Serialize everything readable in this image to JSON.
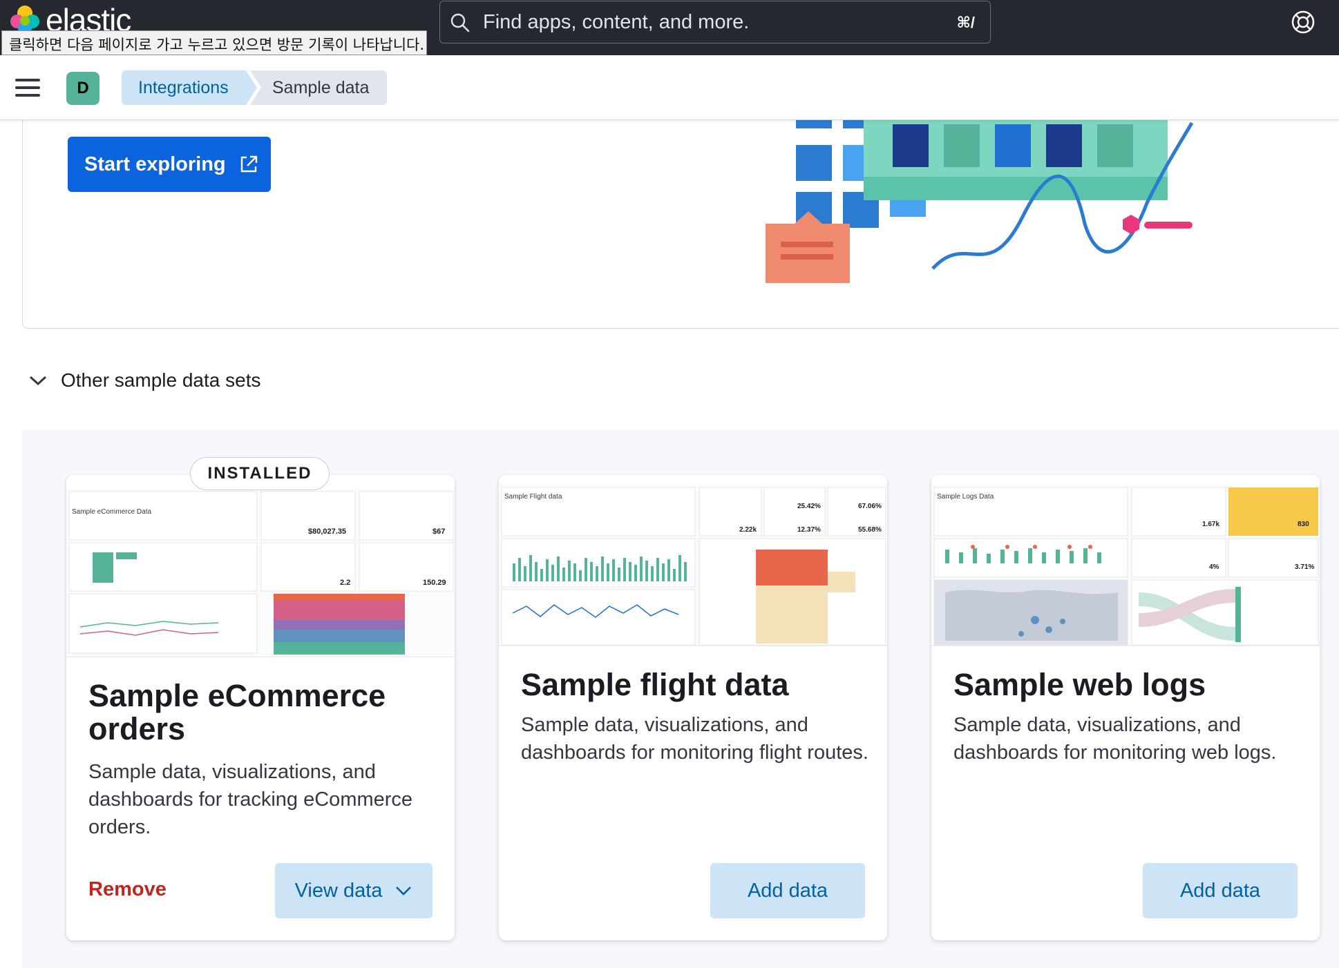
{
  "header": {
    "logo_text": "elastic",
    "tooltip": "클릭하면 다음 페이지로 가고 누르고 있으면 방문 기록이 나타납니다.",
    "search_placeholder": "Find apps, content, and more.",
    "search_shortcut": "⌘/"
  },
  "subheader": {
    "avatar_initial": "D",
    "breadcrumbs": [
      "Integrations",
      "Sample data"
    ]
  },
  "hero": {
    "start_button": "Start exploring"
  },
  "section": {
    "toggle_label": "Other sample data sets"
  },
  "cards": [
    {
      "badge": "INSTALLED",
      "title": "Sample eCommerce orders",
      "description": "Sample data, visualizations, and dashboards for tracking eCommerce orders.",
      "secondary_action": "Remove",
      "primary_action": "View data",
      "preview": {
        "panel_title": "Sample eCommerce Data",
        "stats": [
          "$80,027.35",
          "$67",
          "2.2",
          "150.29"
        ]
      }
    },
    {
      "title": "Sample flight data",
      "description": "Sample data, visualizations, and dashboards for monitoring flight routes.",
      "primary_action": "Add data",
      "preview": {
        "panel_title": "Sample Flight data",
        "stats": [
          "25.42%",
          "67.06%",
          "2.22k",
          "12.37%",
          "55.68%"
        ]
      }
    },
    {
      "title": "Sample web logs",
      "description": "Sample data, visualizations, and dashboards for monitoring web logs.",
      "primary_action": "Add data",
      "preview": {
        "panel_title": "Sample Logs Data",
        "stats": [
          "1.67k",
          "830",
          "4%",
          "3.71%"
        ]
      }
    }
  ],
  "colors": {
    "header_bg": "#25282f",
    "primary": "#0b64dd",
    "light_button": "#cce4f5",
    "danger": "#bd271e",
    "avatar": "#54b399"
  }
}
